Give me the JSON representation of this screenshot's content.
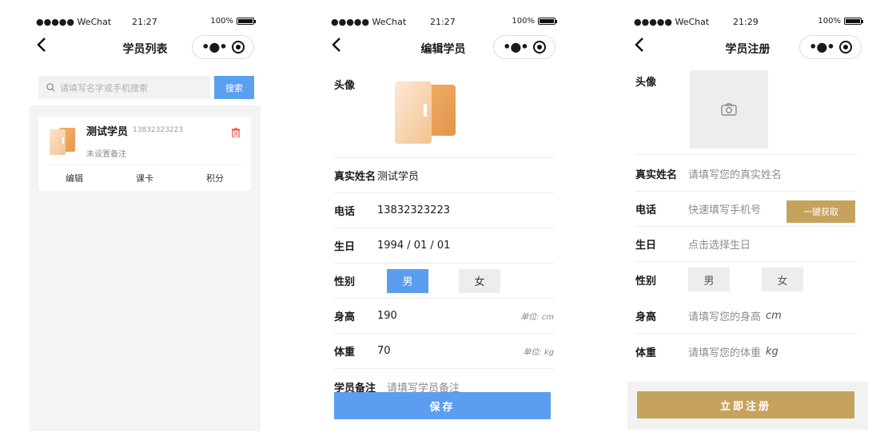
{
  "status_bars": [
    {
      "carrier": "●●●●● WeChat",
      "time": "21:27",
      "battery": "100%"
    },
    {
      "carrier": "●●●●● WeChat",
      "time": "21:27",
      "battery": "100%"
    },
    {
      "carrier": "●●●●● WeChat",
      "time": "21:29",
      "battery": "100%"
    }
  ],
  "student_list": {
    "title": "学员列表",
    "search_placeholder": "请填写名字或手机搜索",
    "search_button": "搜索",
    "card": {
      "name": "测试学员",
      "phone": "13832323223",
      "remark": "未设置备注",
      "actions": [
        "编辑",
        "课卡",
        "积分"
      ]
    }
  },
  "edit_student": {
    "title": "编辑学员",
    "avatar_label": "头像",
    "name_label": "真实姓名",
    "name_value": "测试学员",
    "phone_label": "电话",
    "phone_value": "13832323223",
    "birthday_label": "生日",
    "birthday_value": "1994 / 01 / 01",
    "gender_label": "性别",
    "gender_male": "男",
    "gender_female": "女",
    "height_label": "身高",
    "height_value": "190",
    "height_unit": "单位: cm",
    "weight_label": "体重",
    "weight_value": "70",
    "weight_unit": "单位: kg",
    "remark_label": "学员备注",
    "remark_placeholder": "请填写学员备注",
    "save_button": "保存"
  },
  "register_student": {
    "title": "学员注册",
    "avatar_label": "头像",
    "name_label": "真实姓名",
    "name_placeholder": "请填写您的真实姓名",
    "phone_label": "电话",
    "phone_placeholder": "快速填写手机号",
    "get_phone_button": "一键获取",
    "birthday_label": "生日",
    "birthday_placeholder": "点击选择生日",
    "gender_label": "性别",
    "gender_male": "男",
    "gender_female": "女",
    "height_label": "身高",
    "height_placeholder": "请填写您的身高",
    "height_unit": "cm",
    "weight_label": "体重",
    "weight_placeholder": "请填写您的体重",
    "weight_unit": "kg",
    "register_button": "立即注册"
  },
  "colors": {
    "primary_blue": "#5b9ef0",
    "gold": "#c6a35c",
    "danger_red": "#e54d42"
  }
}
